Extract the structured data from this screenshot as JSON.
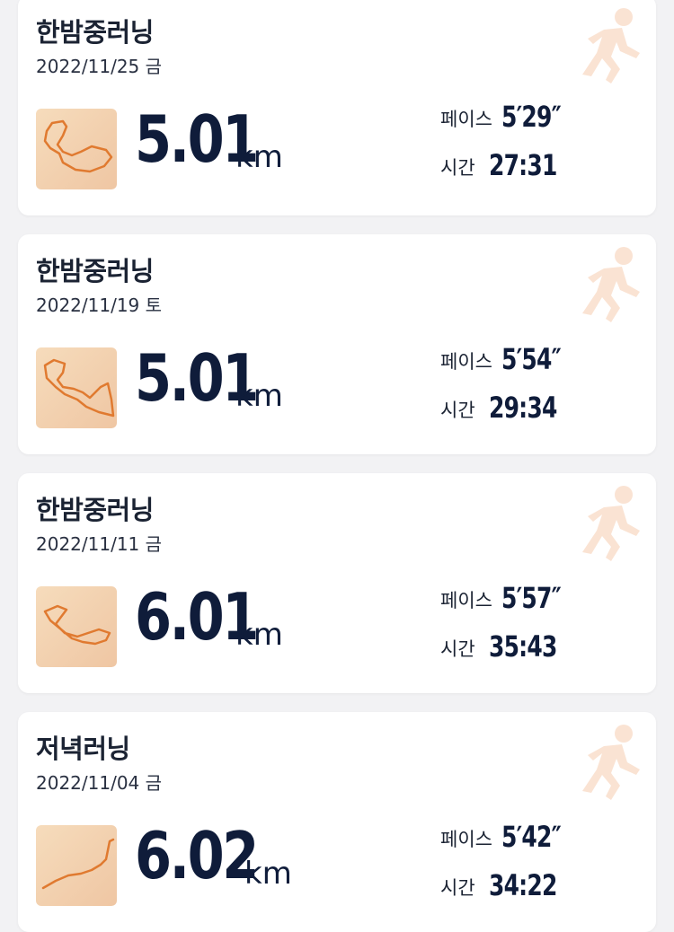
{
  "colors": {
    "accent": "#e07a30",
    "navy": "#0f1c3a",
    "card_bg": "#ffffff",
    "page_bg": "#f2f2f4"
  },
  "labels": {
    "pace": "페이스",
    "time": "시간",
    "unit": "km"
  },
  "runs": [
    {
      "title": "한밤중러닝",
      "date": "2022/11/25 금",
      "distance": "5.01",
      "pace": "5′29″",
      "time": "27:31"
    },
    {
      "title": "한밤중러닝",
      "date": "2022/11/19 토",
      "distance": "5.01",
      "pace": "5′54″",
      "time": "29:34"
    },
    {
      "title": "한밤중러닝",
      "date": "2022/11/11 금",
      "distance": "6.01",
      "pace": "5′57″",
      "time": "35:43"
    },
    {
      "title": "저녁러닝",
      "date": "2022/11/04 금",
      "distance": "6.02",
      "pace": "5′42″",
      "time": "34:22"
    }
  ],
  "icons": {
    "runner": "runner-icon",
    "route": "route-map-icon"
  }
}
